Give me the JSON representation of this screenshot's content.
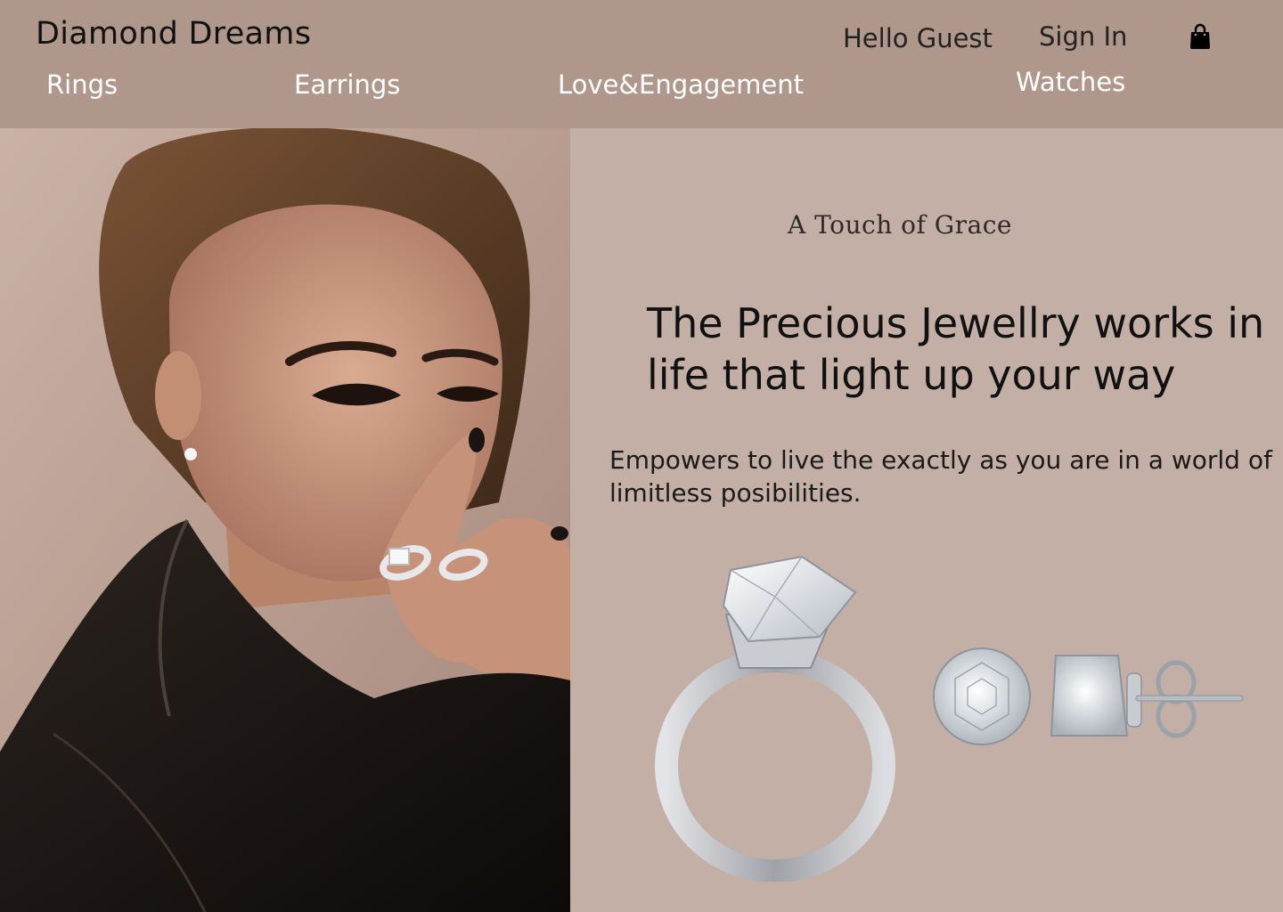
{
  "header": {
    "brand": "Diamond Dreams",
    "greeting": "Hello Guest",
    "sign_in": "Sign In",
    "cart_icon": "shopping-bag-icon",
    "nav": [
      "Rings",
      "Earrings",
      "Love&Engagement",
      "Watches"
    ]
  },
  "hero": {
    "tagline": "A Touch of Grace",
    "headline": "The Precious Jewellry works in life that light up your way",
    "description": "Empowers  to live the exactly as you are in a world of limitless posibilities."
  },
  "colors": {
    "header_bg": "#b0978b",
    "page_bg": "#c3afa6",
    "nav_text": "#ffffff"
  }
}
